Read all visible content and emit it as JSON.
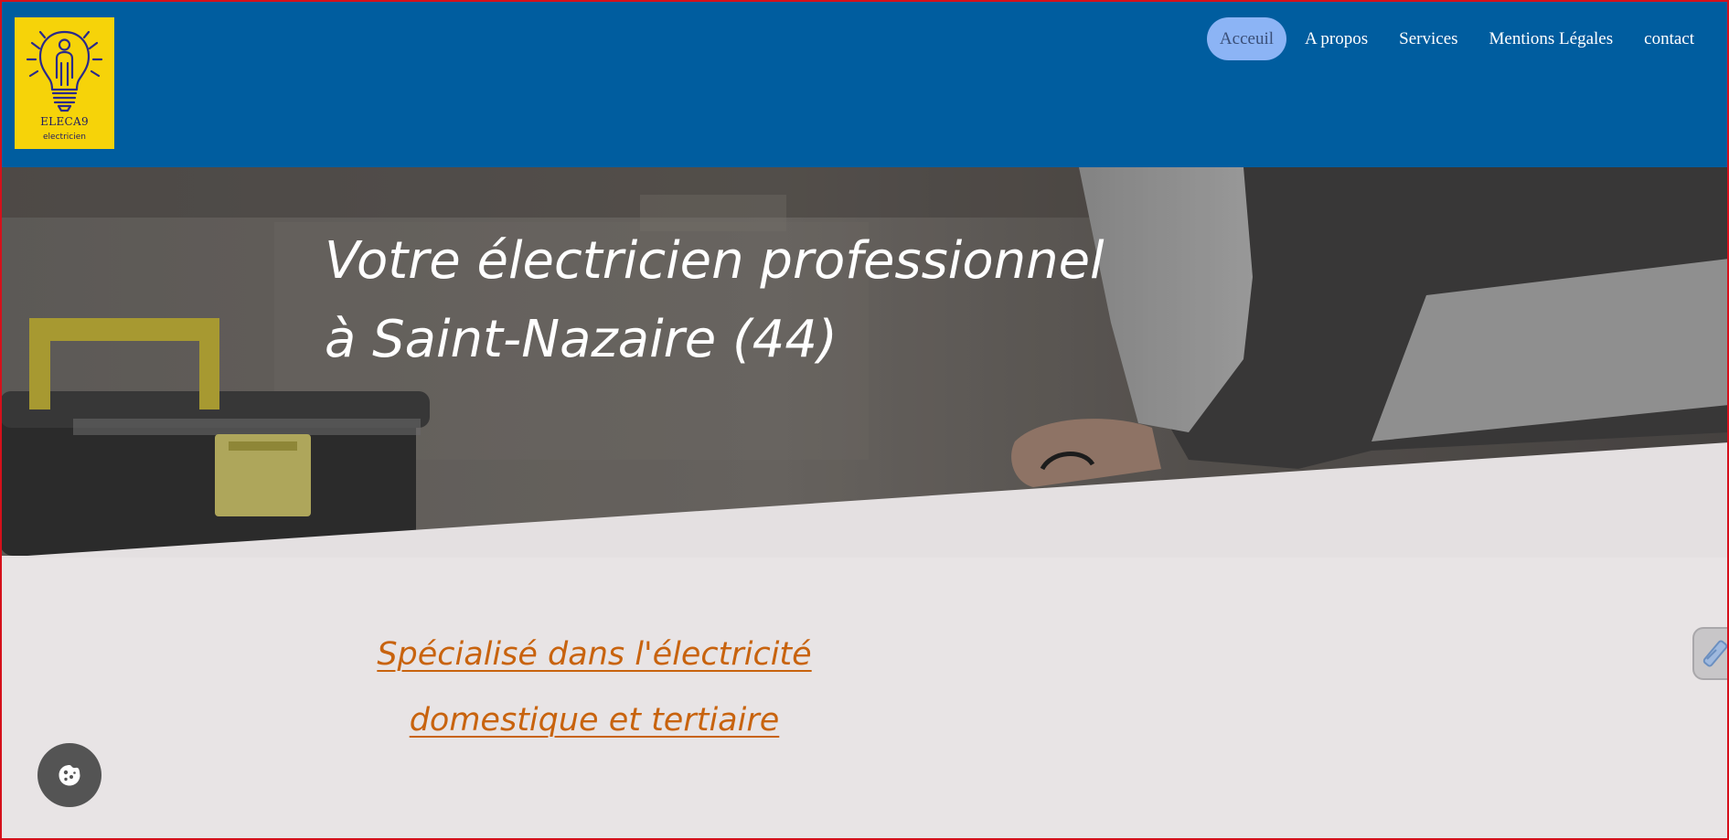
{
  "logo": {
    "brand": "ELECA9",
    "subtitle": "electricien"
  },
  "nav": {
    "items": [
      {
        "label": "Acceuil",
        "active": true
      },
      {
        "label": "A propos"
      },
      {
        "label": "Services"
      },
      {
        "label": "Mentions Légales"
      },
      {
        "label": "contact"
      }
    ]
  },
  "hero": {
    "title_line1": "Votre électricien professionnel",
    "title_line2": "à Saint-Nazaire (44)"
  },
  "specialty": {
    "line1": "Spécialisé dans l'électricité",
    "line2": "domestique et tertiaire "
  },
  "colors": {
    "header_bg": "#005d9f",
    "logo_bg": "#f6d309",
    "nav_active_bg": "#8cb4f5",
    "section_bg": "#e8e4e5",
    "accent_orange": "#c8630e",
    "cookie_bg": "#545454",
    "frame_border": "#d5101b"
  },
  "icons": {
    "logo": "lightbulb-person-icon",
    "cookie": "cookie-icon",
    "side_tab": "pencil-icon"
  }
}
